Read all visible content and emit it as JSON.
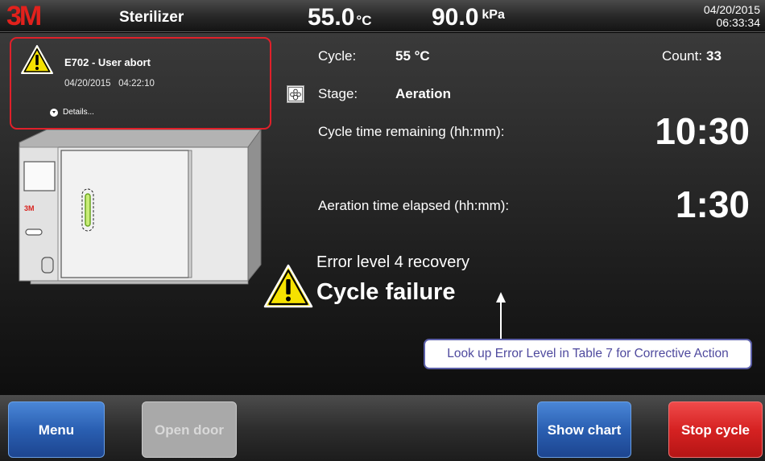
{
  "header": {
    "logo": "3M",
    "title": "Sterilizer",
    "temperature": {
      "value": "55.0",
      "unit": "°C"
    },
    "pressure": {
      "value": "90.0",
      "unit": "kPa"
    },
    "date": "04/20/2015",
    "time": "06:33:34"
  },
  "alert": {
    "code": "E702 - User abort",
    "datetime": "04/20/2015   04:22:10",
    "details_label": "Details..."
  },
  "machine": {
    "brand": "3M"
  },
  "status": {
    "cycle_label": "Cycle:",
    "cycle_value": "55 °C",
    "count_label": "Count:",
    "count_value": "33",
    "stage_label": "Stage:",
    "stage_value": "Aeration",
    "remaining_label": "Cycle time remaining (hh:mm):",
    "remaining_value": "10:30",
    "elapsed_label": "Aeration time elapsed (hh:mm):",
    "elapsed_value": "1:30",
    "error_level": "Error level 4 recovery",
    "failure": "Cycle failure"
  },
  "callout": {
    "text": "Look up Error Level in Table 7 for Corrective Action"
  },
  "footer": {
    "menu": "Menu",
    "open_door": "Open door",
    "show_chart": "Show chart",
    "stop_cycle": "Stop cycle"
  },
  "colors": {
    "alert_border": "#e0202a",
    "primary_button": "#2a5fb2",
    "danger_button": "#d62222",
    "disabled_button": "#a9a9a9",
    "warning_yellow": "#f5e100",
    "callout_text": "#4f4a9e"
  },
  "icons": {
    "alert": "warning-triangle-icon",
    "details": "chevron-down-circle-icon",
    "stage": "stage-aeration-icon",
    "failure": "warning-triangle-icon",
    "callout": "arrow-up-icon"
  }
}
